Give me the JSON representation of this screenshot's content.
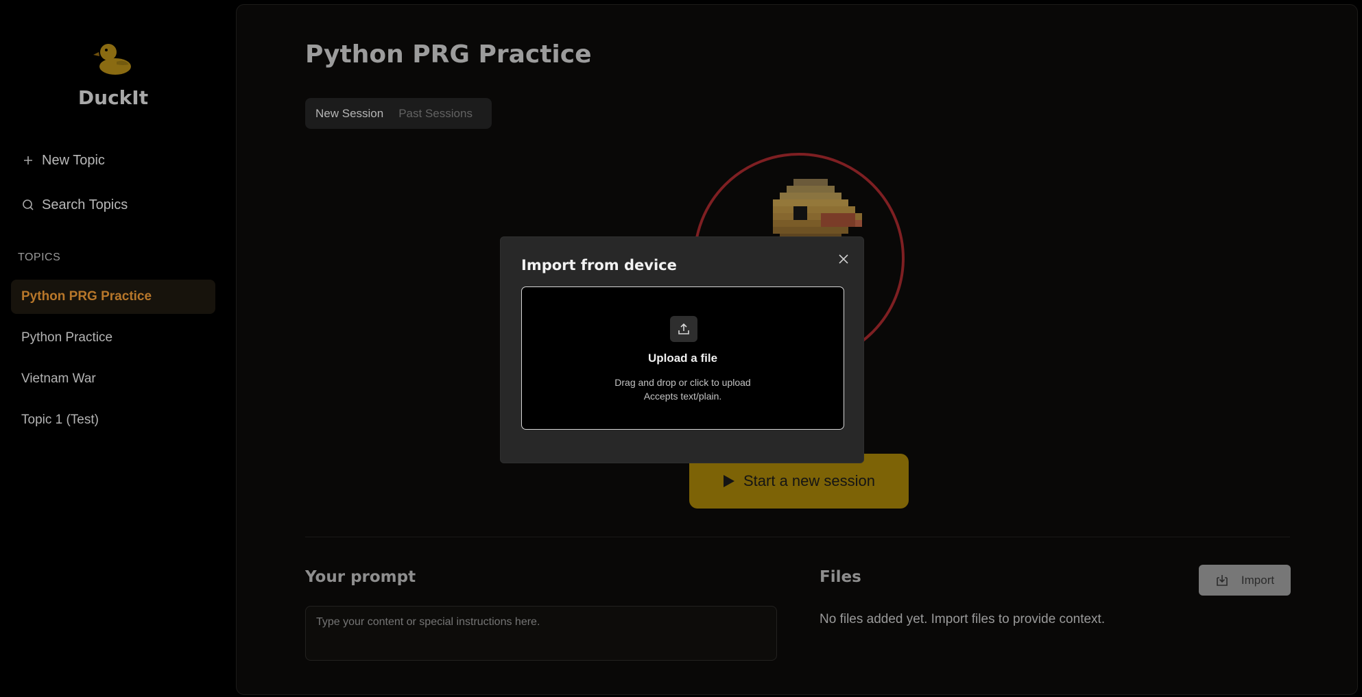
{
  "app": {
    "brand": "DuckIt"
  },
  "sidebar": {
    "new_topic_label": "New Topic",
    "search_topics_label": "Search Topics",
    "topics_heading": "TOPICS",
    "topics": [
      {
        "label": "Python PRG Practice",
        "active": true
      },
      {
        "label": "Python Practice",
        "active": false
      },
      {
        "label": "Vietnam War",
        "active": false
      },
      {
        "label": "Topic 1 (Test)",
        "active": false
      }
    ]
  },
  "main": {
    "title": "Python PRG Practice",
    "tabs": [
      {
        "label": "New Session",
        "active": true
      },
      {
        "label": "Past Sessions",
        "active": false
      }
    ],
    "start_button_label": "Start a new session",
    "prompt": {
      "title": "Your prompt",
      "value": "",
      "placeholder": "Type your content or special instructions here."
    },
    "files": {
      "title": "Files",
      "empty_message": "No files added yet. Import files to provide context.",
      "import_button_label": "Import"
    }
  },
  "modal": {
    "title": "Import from device",
    "dropzone": {
      "title": "Upload a file",
      "instruction": "Drag and drop or click to upload",
      "accepts": "Accepts text/plain."
    }
  },
  "colors": {
    "accent": "#b8772a",
    "start_button": "#7d6306",
    "avatar_ring": "#7e1f22",
    "background": "#000000"
  },
  "icons": {
    "logo": "duck-icon",
    "new_topic": "plus-icon",
    "search": "search-icon",
    "start": "play-icon",
    "import": "import-icon",
    "close": "close-icon",
    "upload": "upload-icon"
  }
}
